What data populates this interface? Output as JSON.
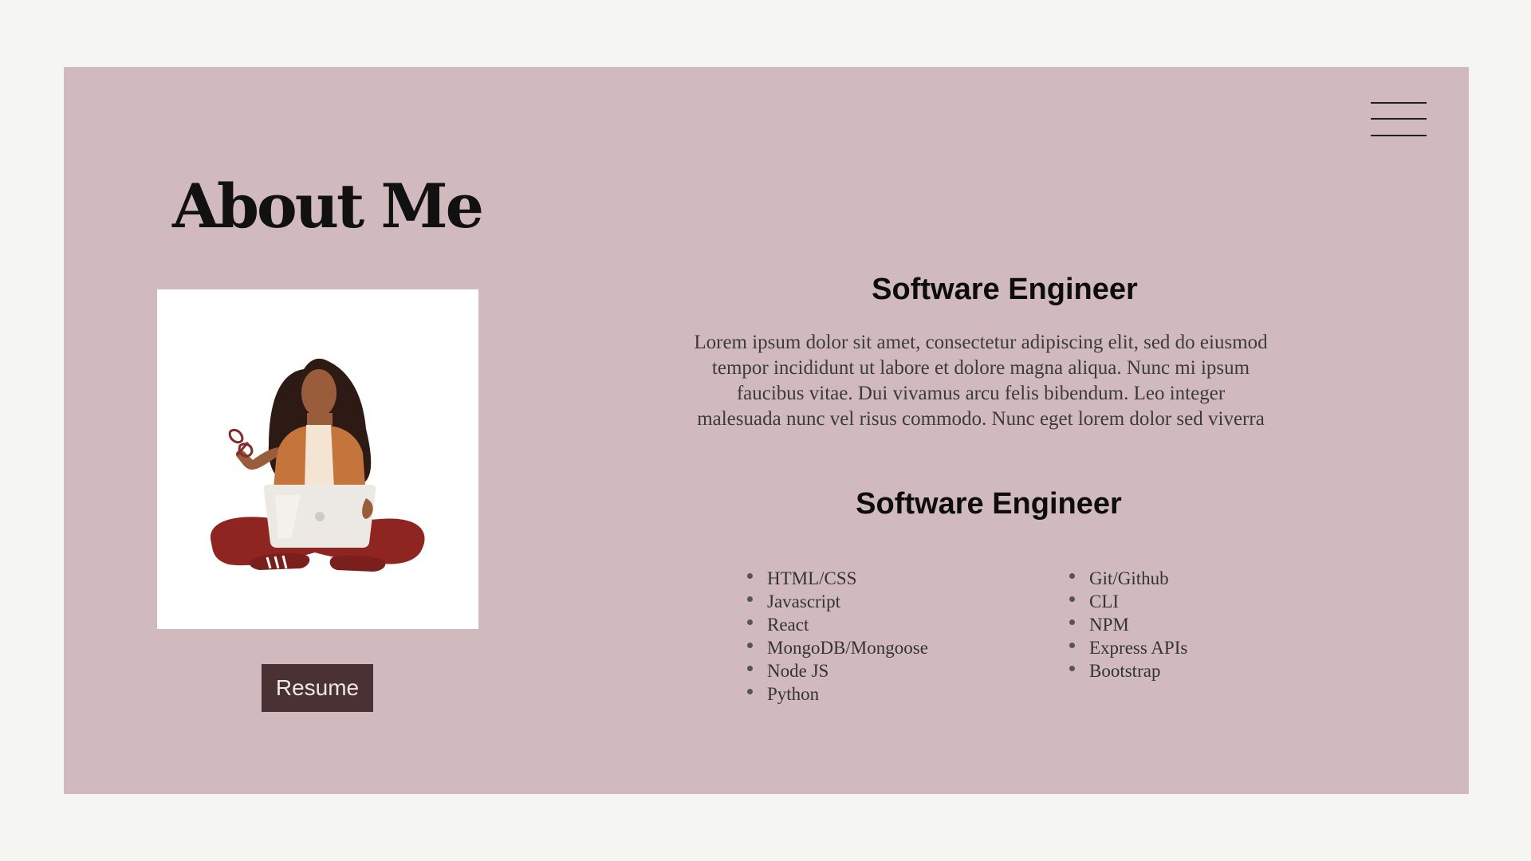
{
  "about": {
    "title": "About Me",
    "resume_label": "Resume",
    "illustration": "woman-with-laptop-illustration"
  },
  "profile": {
    "heading_1": "Software Engineer",
    "bio": "Lorem ipsum dolor sit amet, consectetur adipiscing elit, sed do eiusmod tempor incididunt ut labore et dolore magna aliqua. Nunc mi ipsum faucibus vitae. Dui vivamus arcu felis bibendum. Leo integer malesuada nunc vel risus commodo. Nunc eget lorem dolor sed viverra",
    "heading_2": "Software Engineer"
  },
  "skills": {
    "left": [
      "HTML/CSS",
      "Javascript",
      "React",
      "MongoDB/Mongoose",
      "Node JS",
      "Python"
    ],
    "right": [
      "Git/Github",
      "CLI",
      "NPM",
      "Express APIs",
      "Bootstrap"
    ]
  },
  "colors": {
    "page_background": "#f5f5f1",
    "card_background": "#d1babd",
    "button_background": "#4a3134",
    "button_text": "#f1e6e7"
  },
  "icons": {
    "menu": "hamburger-menu-icon"
  }
}
